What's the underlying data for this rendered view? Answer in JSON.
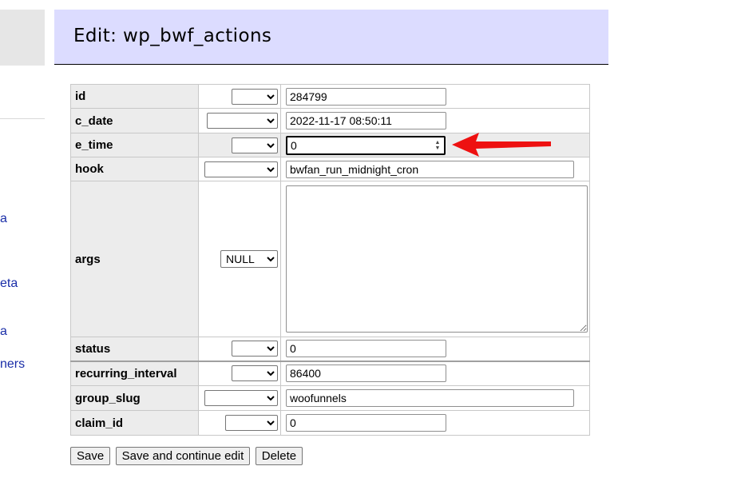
{
  "sidebar": {
    "links": [
      "a",
      "eta",
      "a",
      "ners"
    ]
  },
  "header": {
    "title": "Edit: wp_bwf_actions"
  },
  "fields": [
    {
      "name": "id",
      "func": "",
      "value": "284799"
    },
    {
      "name": "c_date",
      "func": "",
      "value": "2022-11-17 08:50:11"
    },
    {
      "name": "e_time",
      "func": "",
      "value": "0"
    },
    {
      "name": "hook",
      "func": "",
      "value": "bwfan_run_midnight_cron"
    },
    {
      "name": "args",
      "func": "NULL",
      "value": ""
    },
    {
      "name": "status",
      "func": "",
      "value": "0"
    },
    {
      "name": "recurring_interval",
      "func": "",
      "value": "86400"
    },
    {
      "name": "group_slug",
      "func": "",
      "value": "woofunnels"
    },
    {
      "name": "claim_id",
      "func": "",
      "value": "0"
    }
  ],
  "buttons": {
    "save": "Save",
    "save_continue": "Save and continue edit",
    "delete": "Delete"
  },
  "colors": {
    "header_bg": "#dcdcff",
    "label_bg": "#ececec",
    "arrow": "#ee1111",
    "link": "#1a2ea8"
  },
  "icons": {
    "spinner": "up-down-spinner-icon",
    "arrow": "red-pointer-arrow-icon",
    "dropdown": "chevron-down-icon"
  }
}
